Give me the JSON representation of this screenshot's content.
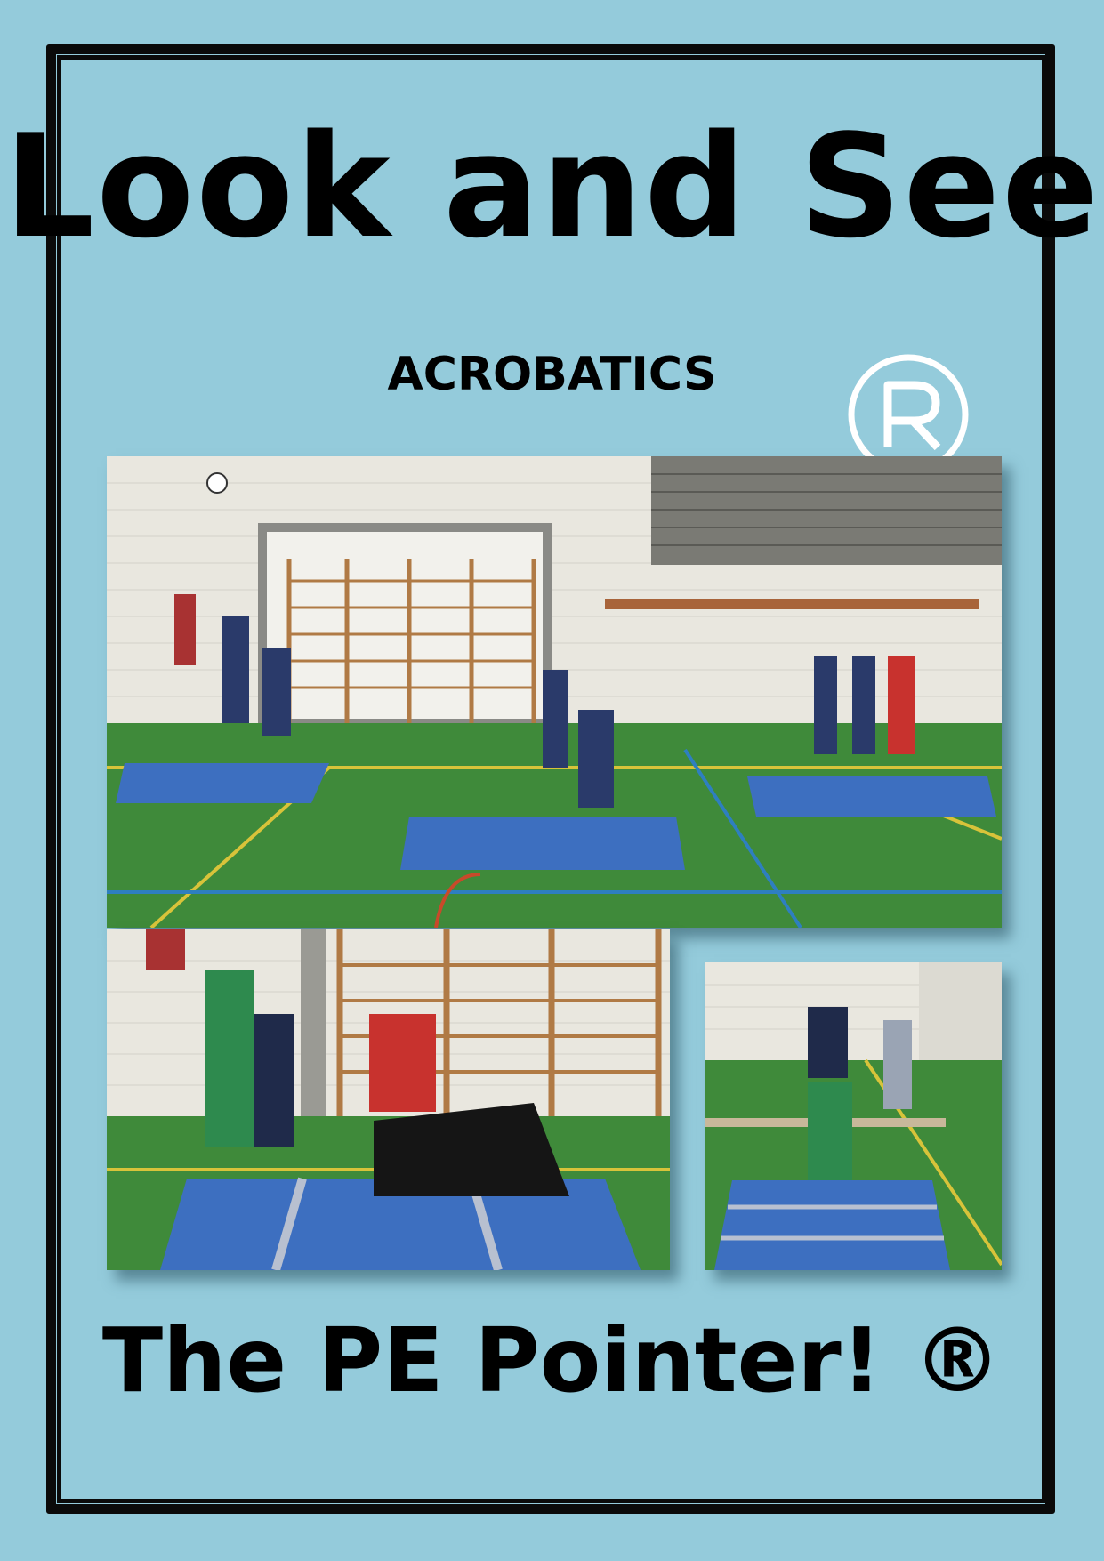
{
  "document": {
    "title": "Look and See",
    "subtitle": "ACROBATICS",
    "footer": "The PE Pointer! ®"
  },
  "colors": {
    "background": "#94cbdb",
    "border": "#0a0a0a",
    "text": "#000000",
    "floor": "#3f8a3a",
    "mat": "#3d6fc0",
    "wall": "#e9e7df"
  },
  "images": [
    {
      "name": "gym-photo-acrobatics-groups"
    },
    {
      "name": "gym-photo-group-balance"
    },
    {
      "name": "gym-photo-pair-balance"
    }
  ]
}
